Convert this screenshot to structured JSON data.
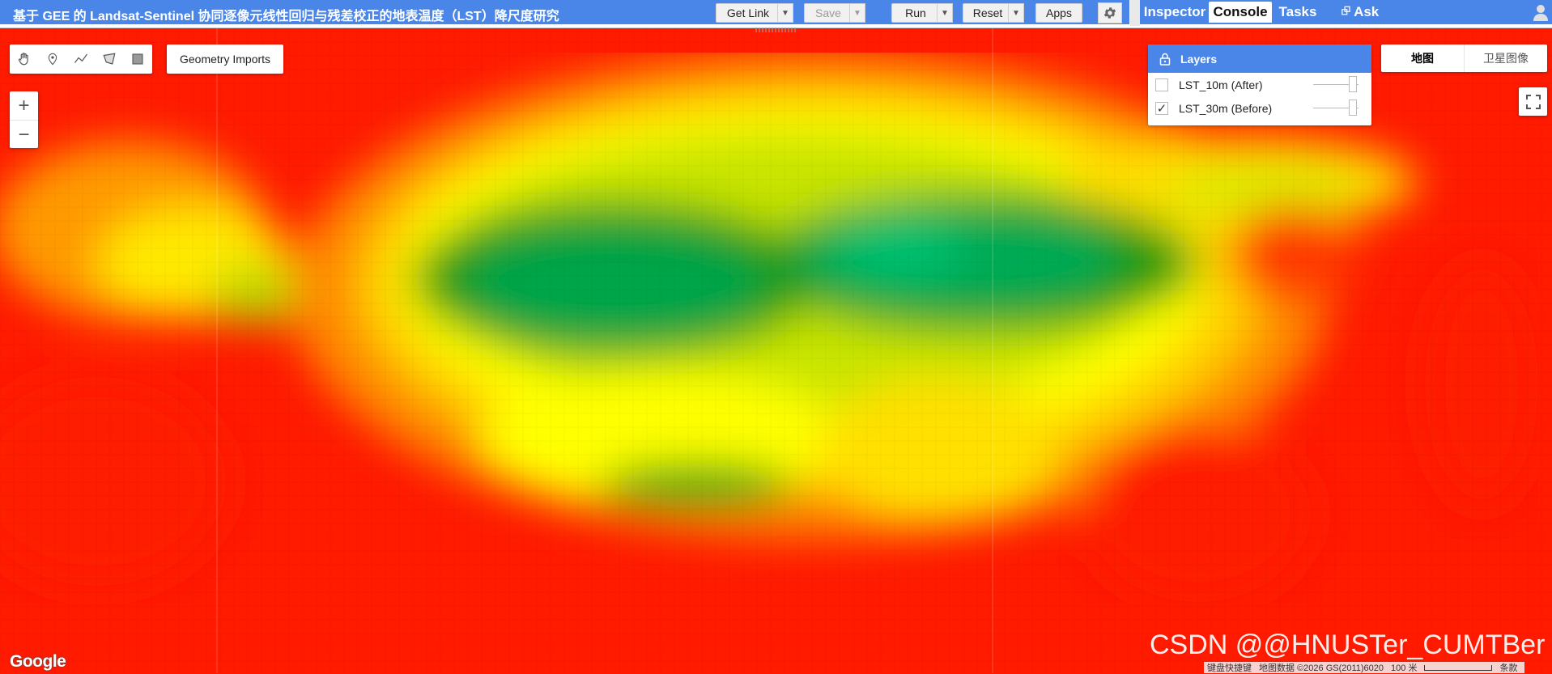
{
  "title": "基于 GEE 的 Landsat-Sentinel 协同逐像元线性回归与残差校正的地表温度（LST）降尺度研究",
  "toolbar": {
    "get_link": "Get Link",
    "save": "Save",
    "run": "Run",
    "reset": "Reset",
    "apps": "Apps"
  },
  "right_tabs": [
    "Inspector",
    "Console",
    "Tasks",
    "Ask"
  ],
  "active_tab": "Console",
  "map": {
    "geometry_imports": "Geometry Imports",
    "zoom_in": "+",
    "zoom_out": "−",
    "layers_title": "Layers",
    "layers": [
      {
        "name": "LST_10m (After)",
        "checked": false,
        "checkmark": ""
      },
      {
        "name": "LST_30m (Before)",
        "checked": true,
        "checkmark": "✓"
      }
    ],
    "map_types": [
      "地图",
      "卫星图像"
    ],
    "active_map_type": "地图",
    "google_logo": "Google",
    "watermark": "CSDN @@HNUSTer_CUMTBer",
    "attribution": {
      "shortcuts": "键盘快捷键",
      "map_data": "地图数据 ©2026 GS(2011)6020",
      "scale": "100 米",
      "terms": "条款"
    }
  },
  "colors": {
    "header_blue": "#4a86e8",
    "lst_hot": "#ff1a00",
    "lst_warm": "#ff9a00",
    "lst_mid": "#ffff00",
    "lst_cool": "#7ec800",
    "lst_cold": "#00b060"
  }
}
